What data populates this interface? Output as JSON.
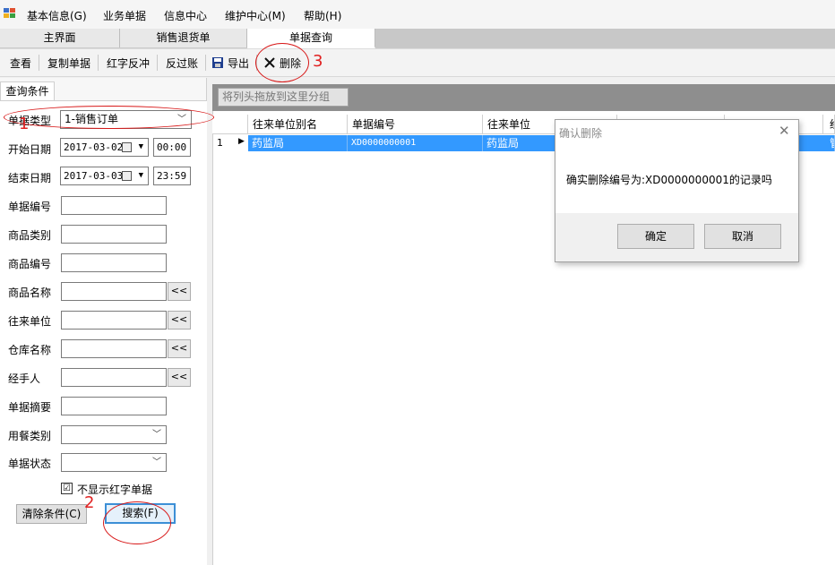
{
  "menubar": {
    "items": [
      {
        "label": "基本信息(G)",
        "mnemonic": "G"
      },
      {
        "label": "业务单据"
      },
      {
        "label": "信息中心"
      },
      {
        "label": "维护中心(M)"
      },
      {
        "label": "帮助(H)"
      }
    ]
  },
  "tabs": [
    {
      "label": "主界面"
    },
    {
      "label": "销售退货单"
    },
    {
      "label": "单据查询"
    }
  ],
  "toolbar": {
    "view": "查看",
    "copy": "复制单据",
    "red_reverse": "红字反冲",
    "reverse_post": "反过账",
    "export": "导出",
    "delete": "删除"
  },
  "left_panel": {
    "tab": "查询条件",
    "fields": {
      "doc_type_label": "单据类型",
      "doc_type_value": "1-销售订单",
      "start_date_label": "开始日期",
      "start_date": "2017-03-02",
      "start_time": "00:00",
      "end_date_label": "结束日期",
      "end_date": "2017-03-03",
      "end_time": "23:59",
      "doc_no_label": "单据编号",
      "product_category_label": "商品类别",
      "product_code_label": "商品编号",
      "product_name_label": "商品名称",
      "partner_label": "往来单位",
      "warehouse_label": "仓库名称",
      "handler_label": "经手人",
      "summary_label": "单据摘要",
      "meal_type_label": "用餐类别",
      "doc_status_label": "单据状态",
      "pick_button": "<<"
    },
    "hide_red_checkbox": {
      "label": "不显示红字单据",
      "checked": true,
      "mark": "☑"
    },
    "clear_button": "清除条件(C)",
    "search_button": "搜索(F)"
  },
  "grid": {
    "group_hint": "将列头拖放到这里分组",
    "columns": [
      "往来单位别名",
      "单据编号",
      "往来单位",
      "",
      "",
      "经"
    ],
    "rows": [
      {
        "row_no": "1",
        "cells": [
          "药监局",
          "XD0000000001",
          "药监局",
          "",
          "",
          "管"
        ]
      }
    ]
  },
  "dialog": {
    "title": "确认删除",
    "message": "确实删除编号为:XD0000000001的记录吗",
    "ok": "确定",
    "cancel": "取消"
  },
  "annotations": {
    "n1": "1",
    "n2": "2",
    "n3": "3",
    "color": "#e02020"
  },
  "colors": {
    "selection": "#3399ff",
    "focus_border": "#3c8fd6"
  }
}
